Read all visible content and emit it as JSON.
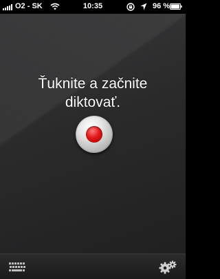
{
  "status_bar": {
    "carrier": "O2 - SK",
    "time": "10:35",
    "battery_percent": "96 %",
    "signal_bars": 5,
    "battery_level": 0.96,
    "icons": [
      "signal-icon",
      "wifi-icon",
      "rotation-lock-icon",
      "location-icon",
      "battery-icon"
    ]
  },
  "main": {
    "prompt_line_1": "Ťuknite a začnite",
    "prompt_line_2": "diktovať.",
    "record_button_icon": "record-icon"
  },
  "toolbar": {
    "keyboard_icon": "keyboard-icon",
    "settings_icon": "gears-icon"
  },
  "colors": {
    "background": "#2a2a2b",
    "record_red": "#e01818",
    "text": "#ffffff"
  }
}
